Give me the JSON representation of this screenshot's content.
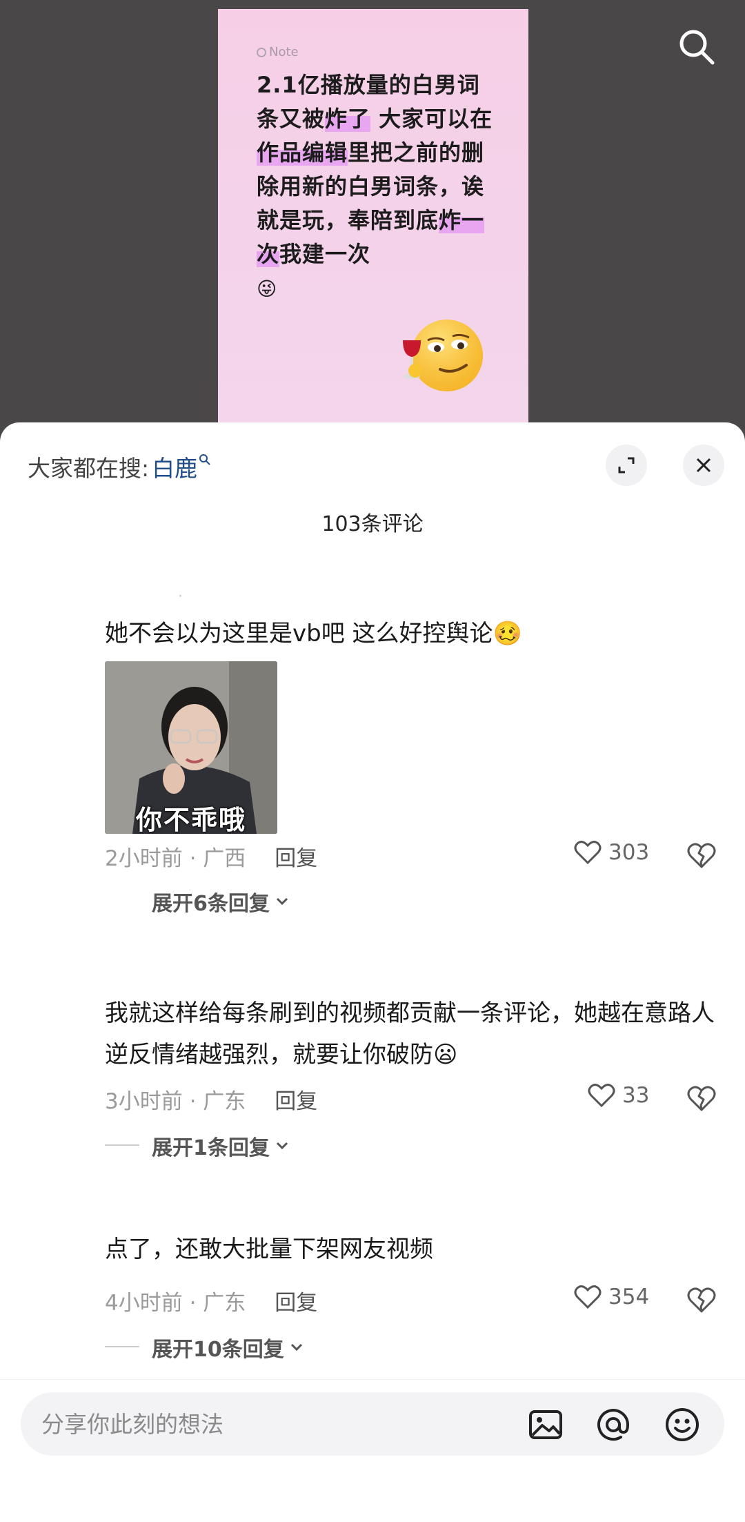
{
  "video": {
    "note_tag": "Note",
    "note_parts": [
      {
        "t": "2.1亿播放量的白男词条又被",
        "hl": false
      },
      {
        "t": "炸了",
        "hl": true
      },
      {
        "t": " 大家可以在",
        "hl": false
      },
      {
        "t": "作品编辑",
        "hl": true
      },
      {
        "t": "里把之前的删除用新的白男词条，诶就是玩，奉陪到底",
        "hl": false
      },
      {
        "t": "炸一次",
        "hl": true
      },
      {
        "t": "我建一次",
        "hl": false
      }
    ],
    "note_emoji": "😜"
  },
  "sheet": {
    "trending_prefix": "大家都在搜:",
    "trending_keyword": "白鹿",
    "comment_count": "103条评论"
  },
  "comments": [
    {
      "user": "·",
      "text": "她不会以为这里是vb吧 这么好控舆论🥴",
      "image_caption": "你不乖哦",
      "time_location": "2小时前 · 广西",
      "reply_label": "回复",
      "likes": "303",
      "expand_label": "展开6条回复"
    },
    {
      "user": "",
      "text": "我就这样给每条刷到的视频都贡献一条评论，她越在意路人逆反情绪越强烈，就要让你破防😦",
      "time_location": "3小时前 · 广东",
      "reply_label": "回复",
      "likes": "33",
      "expand_label": "展开1条回复"
    },
    {
      "user": "",
      "text": "点了，还敢大批量下架网友视频",
      "time_location": "4小时前 · 广东",
      "reply_label": "回复",
      "likes": "354",
      "expand_label": "展开10条回复"
    }
  ],
  "input": {
    "placeholder": "分享你此刻的想法"
  }
}
